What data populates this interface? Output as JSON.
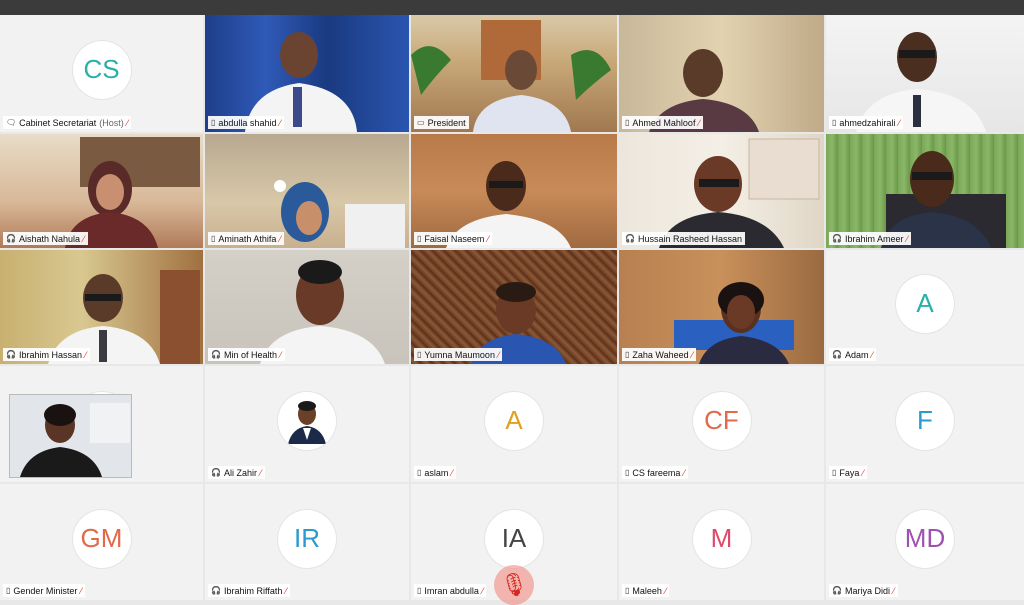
{
  "participants": [
    {
      "name": "Cabinet Secretariat",
      "host_tag": "(Host)",
      "initials": "CS",
      "avatar_color": "#2ab0a8",
      "device": "🗨"
    },
    {
      "name": "abdulla shahid",
      "device": "▯"
    },
    {
      "name": "President",
      "device": "▭"
    },
    {
      "name": "Ahmed Mahloof",
      "device": "▯"
    },
    {
      "name": "ahmedzahirali",
      "device": "▯"
    },
    {
      "name": "Aishath Nahula",
      "device": "🎧"
    },
    {
      "name": "Aminath Athifa",
      "device": "▯"
    },
    {
      "name": "Faisal Naseem",
      "device": "▯"
    },
    {
      "name": "Hussain Rasheed Hassan",
      "device": "🎧"
    },
    {
      "name": "Ibrahim Ameer",
      "device": "🎧"
    },
    {
      "name": "Ibrahim Hassan",
      "device": "🎧"
    },
    {
      "name": "Min of Health",
      "device": "🎧"
    },
    {
      "name": "Yumna Maumoon",
      "device": "▯"
    },
    {
      "name": "Zaha Waheed",
      "device": "▯"
    },
    {
      "name": "Adam",
      "initials": "A",
      "avatar_color": "#2ab0a8",
      "device": "🎧"
    },
    {
      "name": "",
      "device": ""
    },
    {
      "name": "Ali Zahir",
      "device": "🎧"
    },
    {
      "name": "aslam",
      "initials": "A",
      "avatar_color": "#e0a020",
      "device": "▯"
    },
    {
      "name": "CS fareema",
      "initials": "CF",
      "avatar_color": "#e06a4a",
      "device": "▯"
    },
    {
      "name": "Faya",
      "initials": "F",
      "avatar_color": "#2a9ad0",
      "device": "▯"
    },
    {
      "name": "Gender Minister",
      "initials": "GM",
      "avatar_color": "#e06a4a",
      "device": "▯"
    },
    {
      "name": "Ibrahim Riffath",
      "initials": "IR",
      "avatar_color": "#2a9ad0",
      "device": "🎧"
    },
    {
      "name": "Imran abdulla",
      "initials": "IA",
      "avatar_color": "#444444",
      "device": "▯"
    },
    {
      "name": "Maleeh",
      "initials": "M",
      "avatar_color": "#e04a6a",
      "device": "▯"
    },
    {
      "name": "Mariya Didi",
      "initials": "MD",
      "avatar_color": "#a050b0",
      "device": "🎧"
    }
  ],
  "mic_icon": "mic-muted-icon"
}
